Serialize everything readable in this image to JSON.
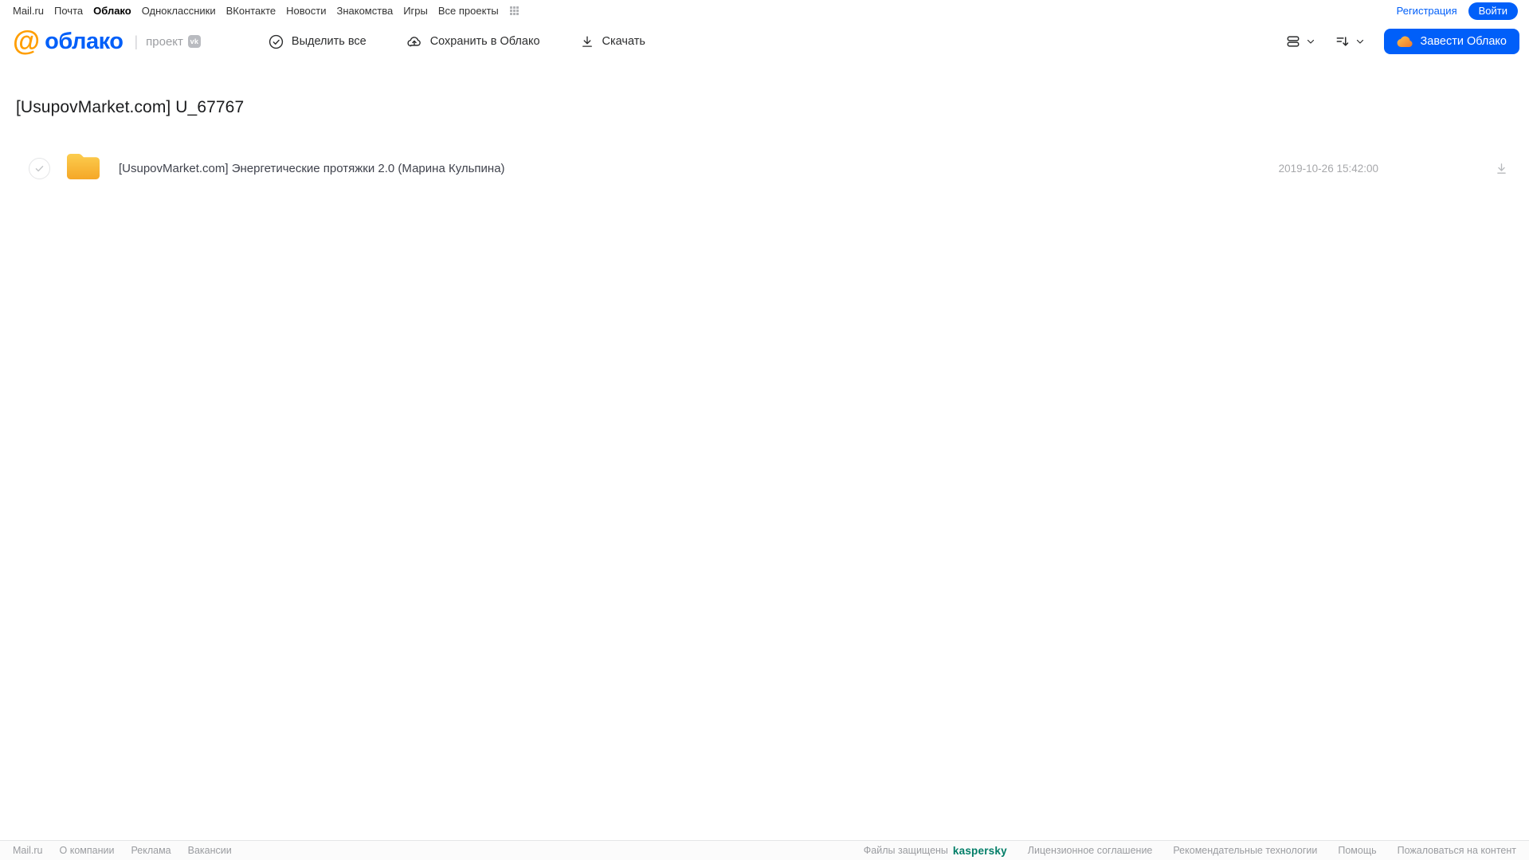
{
  "topbar": {
    "links": [
      {
        "label": "Mail.ru"
      },
      {
        "label": "Почта"
      },
      {
        "label": "Облако"
      },
      {
        "label": "Одноклассники"
      },
      {
        "label": "ВКонтакте"
      },
      {
        "label": "Новости"
      },
      {
        "label": "Знакомства"
      },
      {
        "label": "Игры"
      },
      {
        "label": "Все проекты"
      }
    ],
    "active_link": "Облако",
    "registration_label": "Регистрация",
    "login_label": "Войти"
  },
  "header": {
    "logo_at": "@",
    "logo_text": "облако",
    "logo_divider": "|",
    "project_label": "проект",
    "vk_badge": "vk",
    "toolbar": {
      "select_all_label": "Выделить все",
      "save_to_cloud_label": "Сохранить в Облако",
      "download_label": "Скачать"
    },
    "get_cloud_button_label": "Завести Облако"
  },
  "main": {
    "page_title": "[UsupovMarket.com] U_67767",
    "files": [
      {
        "type": "folder",
        "name": "[UsupovMarket.com] Энергетические протяжки 2.0 (Марина Кульпина)",
        "date": "2019-10-26 15:42:00"
      }
    ]
  },
  "footer": {
    "left_links": [
      {
        "label": "Mail.ru"
      },
      {
        "label": "О компании"
      },
      {
        "label": "Реклама"
      },
      {
        "label": "Вакансии"
      }
    ],
    "protected_label": "Файлы защищены",
    "kaspersky_label": "kaspersky",
    "right_links": [
      {
        "label": "Лицензионное соглашение"
      },
      {
        "label": "Рекомендательные технологии"
      },
      {
        "label": "Помощь"
      },
      {
        "label": "Пожаловаться на контент"
      }
    ]
  },
  "colors": {
    "accent_blue": "#005ff9",
    "logo_orange": "#ff9e00",
    "folder_gradient_top": "#fccd4f",
    "folder_gradient_bottom": "#f5a727",
    "kaspersky_teal": "#007d67",
    "footer_text": "#9a9ca0",
    "date_text": "#a7a8ab"
  }
}
